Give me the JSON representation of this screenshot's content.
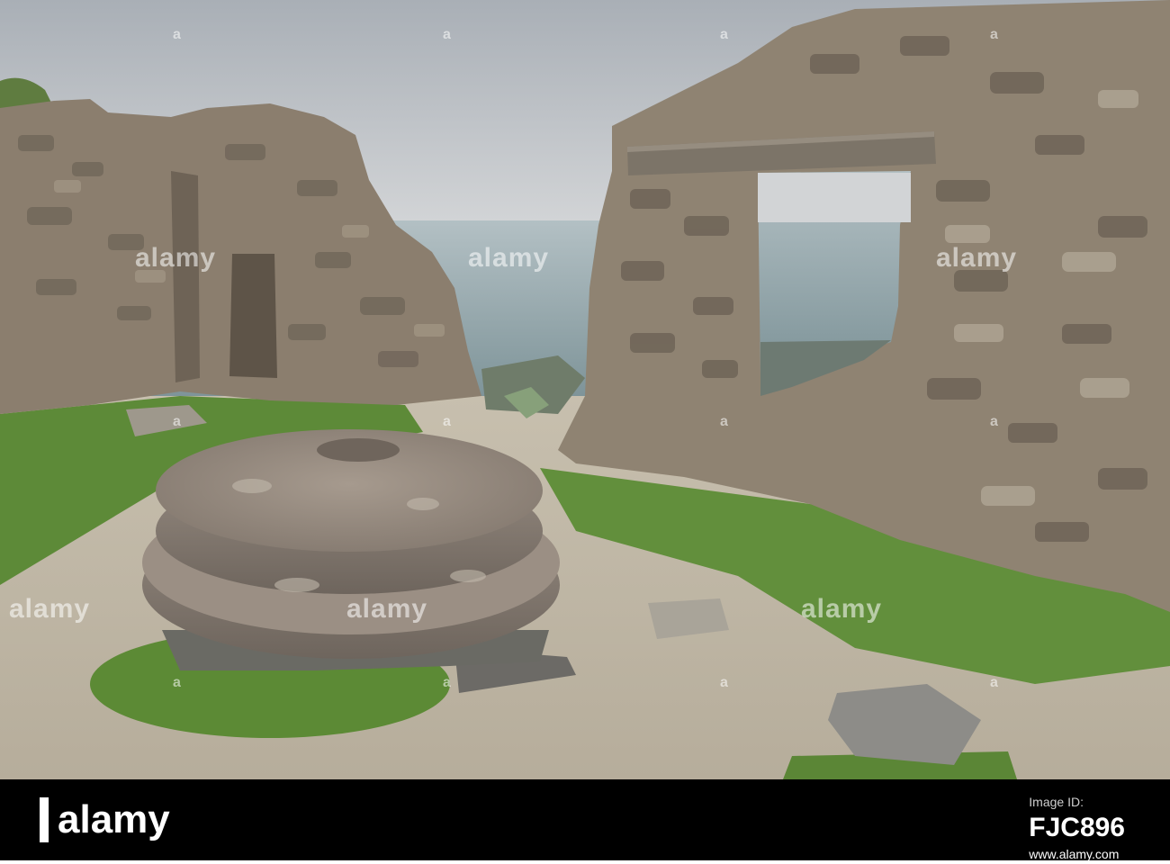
{
  "watermark": {
    "brand": "alamy",
    "small": "a"
  },
  "footer": {
    "logo_text": "alamy",
    "image_id_label": "Image ID:",
    "image_id": "FJC896",
    "site": "www.alamy.com"
  },
  "colors": {
    "sky": "#b9bec4",
    "sea": "#97a8ae",
    "grass": "#5d8a38",
    "stone": "#8a7e70",
    "bar": "#000000"
  }
}
